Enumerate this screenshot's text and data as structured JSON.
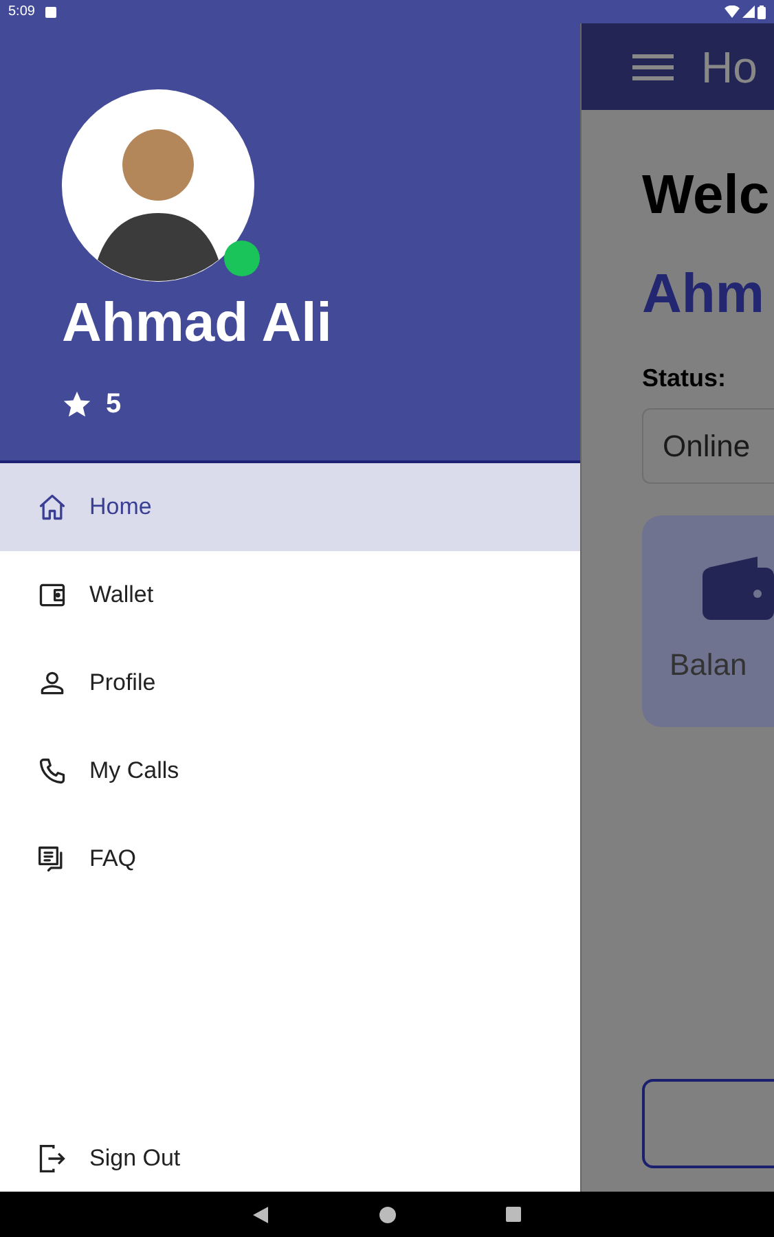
{
  "status_bar": {
    "time": "5:09"
  },
  "drawer": {
    "user_name": "Ahmad Ali",
    "online": true,
    "rating": "5",
    "items": [
      {
        "label": "Home",
        "selected": true
      },
      {
        "label": "Wallet",
        "selected": false
      },
      {
        "label": "Profile",
        "selected": false
      },
      {
        "label": "My Calls",
        "selected": false
      },
      {
        "label": "FAQ",
        "selected": false
      }
    ],
    "sign_out": {
      "label": "Sign Out"
    }
  },
  "app_bar": {
    "title": "Ho"
  },
  "content": {
    "welcome": "Welc",
    "name": "Ahm",
    "status_label": "Status:",
    "status_value": "Online",
    "card_label": "Balan"
  }
}
